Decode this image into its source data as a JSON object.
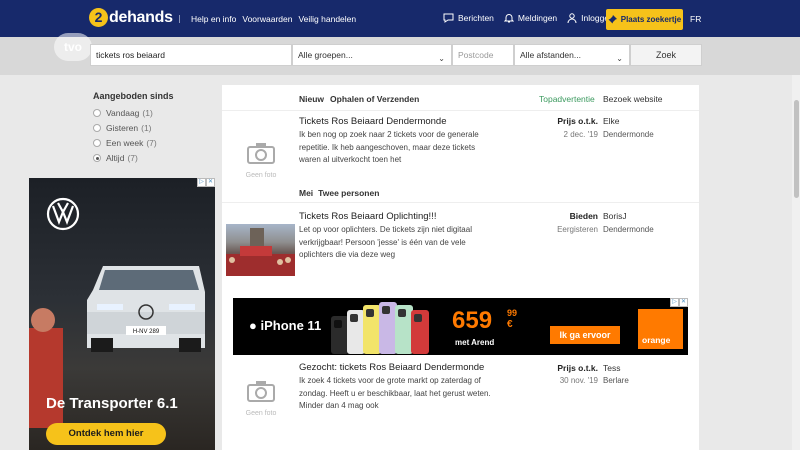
{
  "header": {
    "logo_mark": "2",
    "logo_text": "dehands",
    "links": [
      "Help en info",
      "Voorwaarden",
      "Veilig handelen"
    ],
    "berichten": "Berichten",
    "meldingen": "Meldingen",
    "inloggen": "Inloggen",
    "place_button": "Plaats zoekertje",
    "language": "FR"
  },
  "watermark": "tvo",
  "search": {
    "query": "tickets ros beiaard",
    "group": "Alle groepen...",
    "postcode_placeholder": "Postcode",
    "distance": "Alle afstanden...",
    "button": "Zoek"
  },
  "filters": {
    "title": "Aangeboden sinds",
    "options": [
      {
        "label": "Vandaag",
        "count": "(1)",
        "selected": false
      },
      {
        "label": "Gisteren",
        "count": "(1)",
        "selected": false
      },
      {
        "label": "Een week",
        "count": "(7)",
        "selected": false
      },
      {
        "label": "Altijd",
        "count": "(7)",
        "selected": true
      }
    ]
  },
  "vw_ad": {
    "title": "De Transporter 6.1",
    "button": "Ontdek hem hier",
    "plate": "H-NV 289"
  },
  "listings_header": {
    "tab_new": "Nieuw",
    "tab_delivery": "Ophalen of Verzenden",
    "top_ad": "Topadvertentie",
    "visit": "Bezoek website"
  },
  "listings": [
    {
      "title": "Tickets Ros Beiaard Dendermonde",
      "desc": "Ik ben nog op zoek naar 2 tickets voor de generale repetitie. Ik heb aangeschoven, maar deze tickets waren al uitverkocht toen het",
      "price": "Prijs o.t.k.",
      "date": "2 dec. '19",
      "seller": "Elke",
      "location": "Dendermonde",
      "no_photo": "Geen foto"
    },
    {
      "title": "Tickets Ros Beiaard Oplichting!!!",
      "desc": "Let op voor oplichters. De tickets zijn niet digitaal verkrijgbaar! Persoon 'jesse' is één van de vele oplichters die via deze weg",
      "price": "Bieden",
      "date": "Eergisteren",
      "seller": "BorisJ",
      "location": "Dendermonde"
    },
    {
      "title": "Gezocht: tickets Ros Beiaard Dendermonde",
      "desc": "Ik zoek 4 tickets voor de grote markt op zaterdag of zondag. Heeft u er beschikbaar, laat het gerust weten. Minder dan 4 mag ook",
      "price": "Prijs o.t.k.",
      "date": "30 nov. '19",
      "seller": "Tess",
      "location": "Berlare",
      "no_photo": "Geen foto"
    }
  ],
  "section_label": {
    "month": "Mei",
    "persons": "Twee personen"
  },
  "iphone_ad": {
    "product": "iPhone 11",
    "price": "659",
    "cents": "99",
    "euro": "€",
    "with": "met Arend",
    "button": "Ik ga ervoor",
    "brand": "orange"
  },
  "colors": {
    "header_bg": "#17296b",
    "accent_yellow": "#f6c21a",
    "top_ad_green": "#3c9a5f",
    "orange": "#ff7a00"
  }
}
